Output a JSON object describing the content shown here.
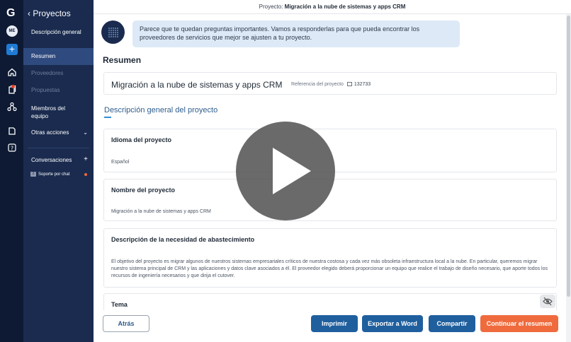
{
  "topbar": {
    "prefix": "Proyecto:",
    "project_name": "Migración a la nube de sistemas y apps CRM"
  },
  "rail": {
    "logo": "G",
    "user_initials": "ME",
    "add": "+",
    "icons": [
      "home-icon",
      "documents-icon",
      "network-icon",
      "files-icon",
      "help-icon"
    ],
    "notification_color": "#e8462e"
  },
  "nav": {
    "back_title": "Proyectos",
    "items": [
      {
        "label": "Descripción general",
        "state": "normal"
      },
      {
        "label": "Resumen",
        "state": "active"
      },
      {
        "label": "Proveedores",
        "state": "muted"
      },
      {
        "label": "Propuestas",
        "state": "muted"
      },
      {
        "label": "Miembros del equipo",
        "state": "normal"
      },
      {
        "label": "Otras acciones",
        "state": "normal"
      }
    ],
    "conversations_label": "Conversaciones",
    "conversations_add": "+",
    "chat_label": "Soporte por chat"
  },
  "assistant": {
    "message": "Parece que te quedan preguntas importantes. Vamos a responderlas para que pueda encontrar los proveedores de servicios que mejor se ajusten a tu proyecto."
  },
  "summary": {
    "heading": "Resumen",
    "project_title": "Migración a la nube de sistemas y apps CRM",
    "reference_label": "Referencia del proyecto",
    "reference_number": "132733",
    "section_title": "Descripción general del proyecto",
    "fields": [
      {
        "label": "Idioma del proyecto",
        "value": "Español"
      },
      {
        "label": "Nombre del proyecto",
        "value": "Migración a la nube de sistemas y apps CRM"
      },
      {
        "label": "Descripción de la necesidad de abastecimiento",
        "value": "El objetivo del proyecto es migrar algunos de nuestros sistemas empresariales críticos de nuestra costosa y cada vez más obsoleta infraestructura local a la nube. En particular, queremos migrar nuestro sistema principal de CRM y las aplicaciones y datos clave asociados a él. El proveedor elegido deberá proporcionar un equipo que realice el trabajo de diseño necesario, que aporte todos los recursos de ingeniería necesarios y que dirija el cutover."
      },
      {
        "label": "Tema",
        "value": ""
      }
    ]
  },
  "footer": {
    "back": "Atrás",
    "print": "Imprimir",
    "export": "Exportar a Word",
    "share": "Compartir",
    "continue": "Continuar el resumen"
  },
  "colors": {
    "rail": "#0e1a33",
    "sidebar": "#1a2b4f",
    "primary_button": "#1f5f9e",
    "accent_button": "#ef6b3d"
  }
}
